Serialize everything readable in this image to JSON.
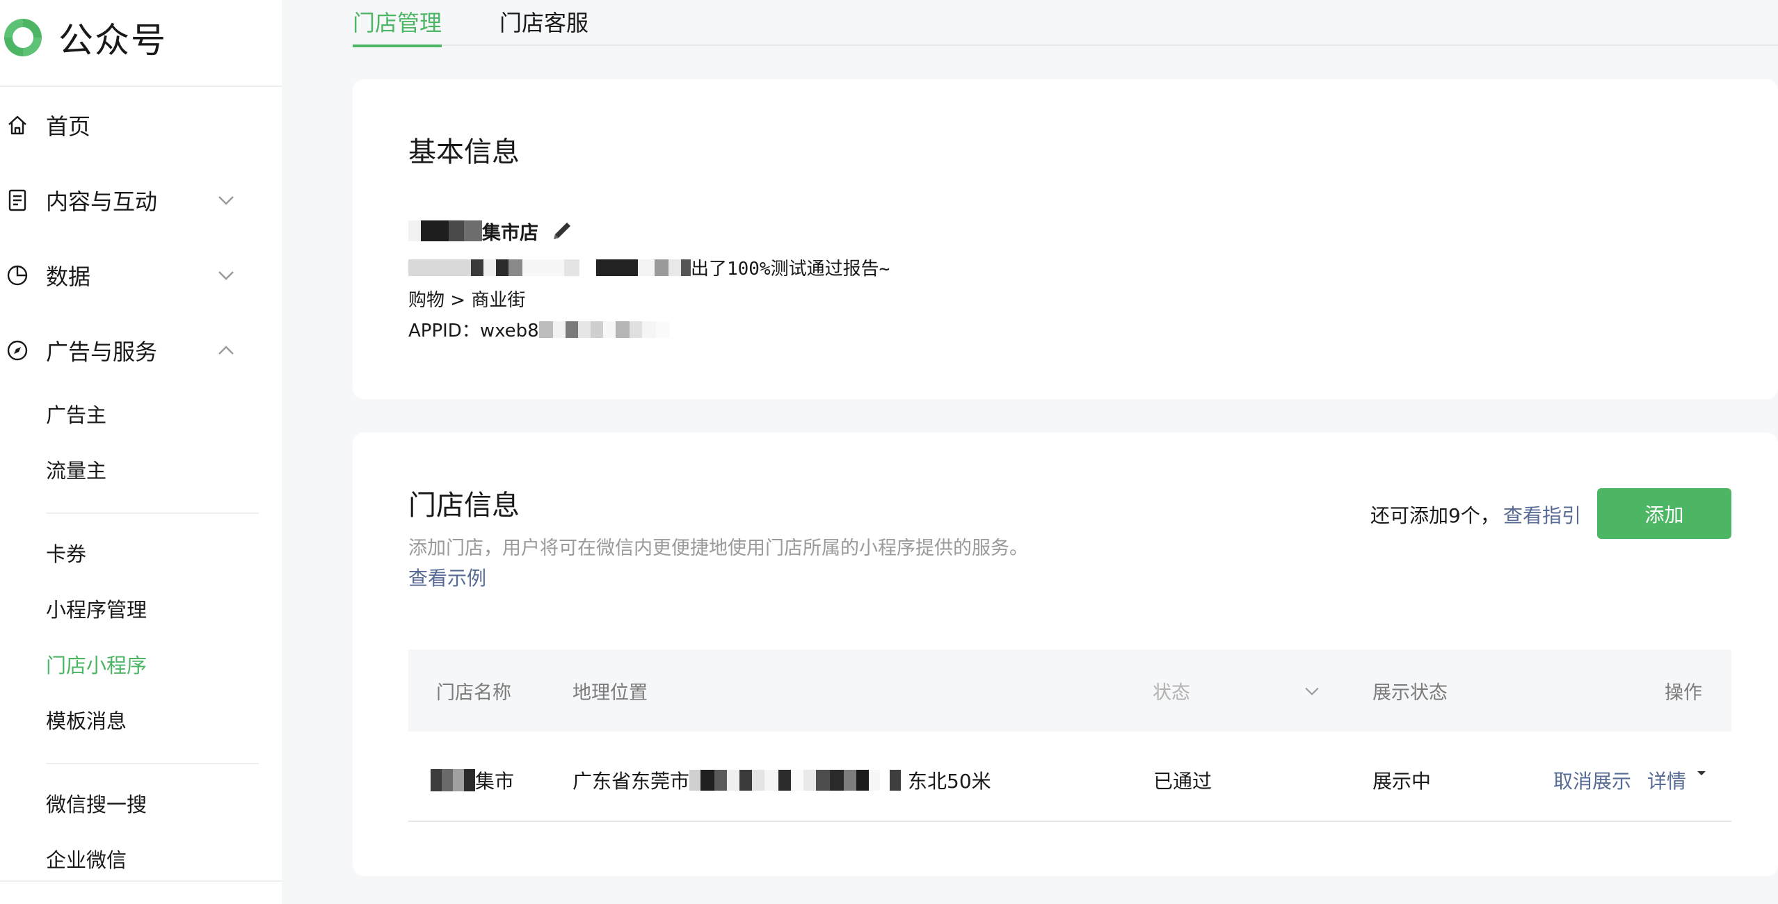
{
  "brand": {
    "name": "公众号",
    "color": "#4db665"
  },
  "sidebar": {
    "items": [
      {
        "label": "首页",
        "icon": "home-icon"
      },
      {
        "label": "内容与互动",
        "icon": "document-icon",
        "expanded": false
      },
      {
        "label": "数据",
        "icon": "pie-chart-icon",
        "expanded": false
      },
      {
        "label": "广告与服务",
        "icon": "compass-icon",
        "expanded": true
      }
    ],
    "sub_group_1": [
      "广告主",
      "流量主"
    ],
    "sub_group_2": [
      "卡券",
      "小程序管理",
      "门店小程序",
      "模板消息"
    ],
    "sub_group_3": [
      "微信搜一搜",
      "企业微信"
    ],
    "active": "门店小程序"
  },
  "tabs": [
    {
      "label": "门店管理",
      "active": true
    },
    {
      "label": "门店客服",
      "active": false
    }
  ],
  "basic_info": {
    "title": "基本信息",
    "store_name_suffix": "集市店",
    "report_text_suffix": "出了100%测试通过报告~",
    "category": "购物 > 商业街",
    "appid_prefix": "APPID：wxeb8"
  },
  "store_info": {
    "title": "门店信息",
    "description": "添加门店，用户将可在微信内更便捷地使用门店所属的小程序提供的服务。",
    "example_link": "查看示例",
    "remaining_text": "还可添加9个，",
    "guide_link": "查看指引",
    "add_button": "添加",
    "columns": {
      "name": "门店名称",
      "location": "地理位置",
      "status": "状态",
      "display_status": "展示状态",
      "actions": "操作"
    },
    "rows": [
      {
        "name_suffix": "集市",
        "location_prefix": "广东省东莞市",
        "location_suffix": "东北50米",
        "status": "已通过",
        "display_status": "展示中",
        "action_cancel": "取消展示",
        "action_detail": "详情"
      }
    ]
  },
  "colors": {
    "accent": "#4db665",
    "link": "#576b95",
    "muted": "#9a9a9a"
  }
}
